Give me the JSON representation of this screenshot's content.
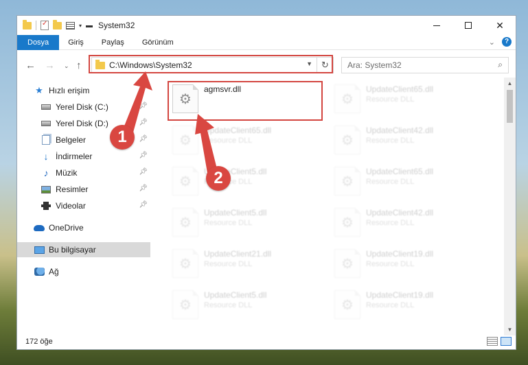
{
  "window": {
    "title": "System32",
    "controls": {
      "minimize": "minimize",
      "maximize": "maximize",
      "close": "✕"
    }
  },
  "ribbon": {
    "tabs": [
      {
        "label": "Dosya",
        "active": true
      },
      {
        "label": "Giriş"
      },
      {
        "label": "Paylaş"
      },
      {
        "label": "Görünüm"
      }
    ]
  },
  "nav": {
    "address": "C:\\Windows\\System32",
    "search_placeholder": "Ara: System32"
  },
  "sidebar": {
    "items": [
      {
        "label": "Hızlı erişim",
        "icon": "star-icon"
      },
      {
        "label": "Yerel Disk (C:)",
        "icon": "disk-icon",
        "pinned": true
      },
      {
        "label": "Yerel Disk (D:)",
        "icon": "disk-icon",
        "pinned": true
      },
      {
        "label": "Belgeler",
        "icon": "documents-icon",
        "pinned": true
      },
      {
        "label": "İndirmeler",
        "icon": "download-icon",
        "pinned": true
      },
      {
        "label": "Müzik",
        "icon": "music-icon",
        "pinned": true
      },
      {
        "label": "Resimler",
        "icon": "pictures-icon",
        "pinned": true
      },
      {
        "label": "Videolar",
        "icon": "videos-icon",
        "pinned": true
      },
      {
        "label": "OneDrive",
        "icon": "onedrive-icon"
      },
      {
        "label": "Bu bilgisayar",
        "icon": "computer-icon",
        "selected": true
      },
      {
        "label": "Ağ",
        "icon": "network-icon"
      }
    ]
  },
  "files": {
    "selected": {
      "name": "agmsvr.dll"
    },
    "faded": [
      {
        "name": "UpdateClient65.dll",
        "type": "Resource DLL"
      },
      {
        "name": "UpdateClient65.dll",
        "type": "Resource DLL"
      },
      {
        "name": "UpdateClient42.dll",
        "type": "Resource DLL"
      },
      {
        "name": "UpdateClient5.dll",
        "type": "Resource DLL"
      },
      {
        "name": "UpdateClient65.dll",
        "type": "Resource DLL"
      },
      {
        "name": "UpdateClient5.dll",
        "type": "Resource DLL"
      },
      {
        "name": "UpdateClient42.dll",
        "type": "Resource DLL"
      },
      {
        "name": "UpdateClient21.dll",
        "type": "Resource DLL"
      },
      {
        "name": "UpdateClient19.dll",
        "type": "Resource DLL"
      },
      {
        "name": "UpdateClient5.dll",
        "type": "Resource DLL"
      },
      {
        "name": "UpdateClient19.dll",
        "type": "Resource DLL"
      }
    ]
  },
  "status": {
    "item_count": "172 öğe"
  },
  "annotations": {
    "step1": "1",
    "step2": "2",
    "color": "#d94741"
  },
  "colors": {
    "accent": "#1979ca",
    "highlight": "#d3453f"
  }
}
